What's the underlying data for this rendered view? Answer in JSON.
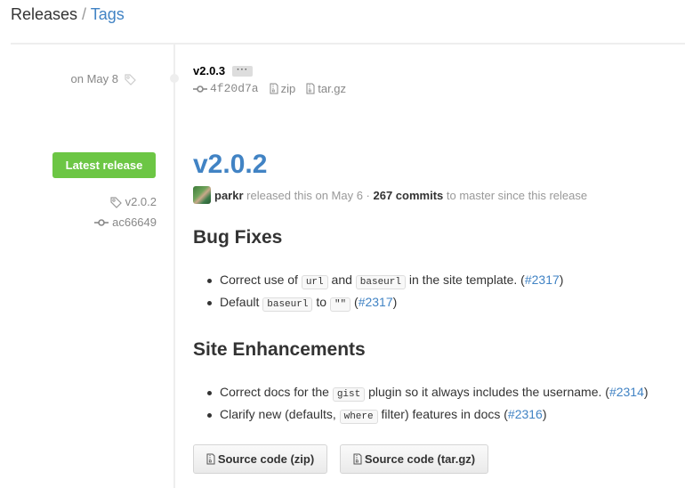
{
  "breadcrumb": {
    "releases": "Releases",
    "separator": " / ",
    "tags": "Tags"
  },
  "tag_entry": {
    "date": "on May 8",
    "name": "v2.0.3",
    "ellipsis": "···",
    "commit": "4f20d7a",
    "zip": "zip",
    "targz": "tar.gz"
  },
  "release": {
    "badge": "Latest release",
    "tag": "v2.0.2",
    "commit": "ac66649",
    "title": "v2.0.2",
    "author": "parkr",
    "released_text": " released this on May 6 · ",
    "commits_count": "267 commits",
    "commits_suffix": " to master since this release",
    "sections": [
      {
        "heading": "Bug Fixes",
        "items": [
          {
            "p1": "Correct use of ",
            "c1": "url",
            "p2": " and ",
            "c2": "baseurl",
            "p3": " in the site template. (",
            "link": "#2317",
            "p4": ")"
          },
          {
            "p1": "Default ",
            "c1": "baseurl",
            "p2": " to ",
            "c2": "\"\"",
            "p3": " (",
            "link": "#2317",
            "p4": ")"
          }
        ]
      },
      {
        "heading": "Site Enhancements",
        "items": [
          {
            "p1": "Correct docs for the ",
            "c1": "gist",
            "p2": " plugin so it always includes the username. (",
            "link": "#2314",
            "p3": ")"
          },
          {
            "p1": "Clarify new (defaults, ",
            "c1": "where",
            "p2": " filter) features in docs (",
            "link": "#2316",
            "p3": ")"
          }
        ]
      }
    ],
    "downloads": {
      "zip": "Source code (zip)",
      "targz": "Source code (tar.gz)"
    }
  },
  "colors": {
    "link": "#4183c4",
    "badge": "#6cc644",
    "muted": "#888888"
  }
}
